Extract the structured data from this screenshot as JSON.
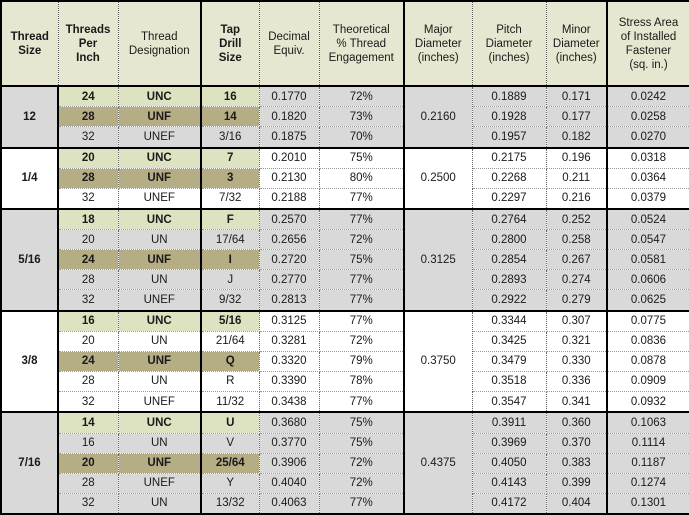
{
  "table": {
    "headers": [
      {
        "id": "thread-size",
        "lines": [
          "Thread",
          "Size"
        ],
        "bold": true
      },
      {
        "id": "threads-per-inch",
        "lines": [
          "Threads",
          "Per",
          "Inch"
        ],
        "bold": true
      },
      {
        "id": "thread-designation",
        "lines": [
          "Thread",
          "Designation"
        ],
        "bold": false
      },
      {
        "id": "tap-drill-size",
        "lines": [
          "Tap",
          "Drill",
          "Size"
        ],
        "bold": true
      },
      {
        "id": "decimal-equiv",
        "lines": [
          "Decimal",
          "Equiv."
        ],
        "bold": false
      },
      {
        "id": "thread-engagement",
        "lines": [
          "Theoretical",
          "% Thread",
          "Engagement"
        ],
        "bold": false
      },
      {
        "id": "major-diameter",
        "lines": [
          "Major",
          "Diameter",
          "(inches)"
        ],
        "bold": false
      },
      {
        "id": "pitch-diameter",
        "lines": [
          "Pitch",
          "Diameter",
          "(inches)"
        ],
        "bold": false
      },
      {
        "id": "minor-diameter",
        "lines": [
          "Minor",
          "Diameter",
          "(inches)"
        ],
        "bold": false
      },
      {
        "id": "stress-area",
        "lines": [
          "Stress Area",
          "of Installed",
          "Fastener",
          "(sq. in.)"
        ],
        "bold": false
      }
    ],
    "colors": {
      "header_bg": "#e7e6d0",
      "band_gray": "#d9d9d9",
      "band_white": "#ffffff",
      "unc_highlight": "#dde3c0",
      "unf_highlight": "#b5ad84",
      "border": "#000000"
    },
    "groups": [
      {
        "thread_size": "12",
        "major_diameter": "0.2160",
        "band": "gray",
        "rows": [
          {
            "tpi": "24",
            "designation": "UNC",
            "tap_drill": "16",
            "decimal": "0.1770",
            "engagement": "72%",
            "pitch": "0.1889",
            "minor": "0.171",
            "stress": "0.0242",
            "style": "unc"
          },
          {
            "tpi": "28",
            "designation": "UNF",
            "tap_drill": "14",
            "decimal": "0.1820",
            "engagement": "73%",
            "pitch": "0.1928",
            "minor": "0.177",
            "stress": "0.0258",
            "style": "unf"
          },
          {
            "tpi": "32",
            "designation": "UNEF",
            "tap_drill": "3/16",
            "decimal": "0.1875",
            "engagement": "70%",
            "pitch": "0.1957",
            "minor": "0.182",
            "stress": "0.0270",
            "style": "plain"
          }
        ]
      },
      {
        "thread_size": "1/4",
        "major_diameter": "0.2500",
        "band": "white",
        "rows": [
          {
            "tpi": "20",
            "designation": "UNC",
            "tap_drill": "7",
            "decimal": "0.2010",
            "engagement": "75%",
            "pitch": "0.2175",
            "minor": "0.196",
            "stress": "0.0318",
            "style": "unc"
          },
          {
            "tpi": "28",
            "designation": "UNF",
            "tap_drill": "3",
            "decimal": "0.2130",
            "engagement": "80%",
            "pitch": "0.2268",
            "minor": "0.211",
            "stress": "0.0364",
            "style": "unf"
          },
          {
            "tpi": "32",
            "designation": "UNEF",
            "tap_drill": "7/32",
            "decimal": "0.2188",
            "engagement": "77%",
            "pitch": "0.2297",
            "minor": "0.216",
            "stress": "0.0379",
            "style": "plain"
          }
        ]
      },
      {
        "thread_size": "5/16",
        "major_diameter": "0.3125",
        "band": "gray",
        "rows": [
          {
            "tpi": "18",
            "designation": "UNC",
            "tap_drill": "F",
            "decimal": "0.2570",
            "engagement": "77%",
            "pitch": "0.2764",
            "minor": "0.252",
            "stress": "0.0524",
            "style": "unc"
          },
          {
            "tpi": "20",
            "designation": "UN",
            "tap_drill": "17/64",
            "decimal": "0.2656",
            "engagement": "72%",
            "pitch": "0.2800",
            "minor": "0.258",
            "stress": "0.0547",
            "style": "plain"
          },
          {
            "tpi": "24",
            "designation": "UNF",
            "tap_drill": "I",
            "decimal": "0.2720",
            "engagement": "75%",
            "pitch": "0.2854",
            "minor": "0.267",
            "stress": "0.0581",
            "style": "unf"
          },
          {
            "tpi": "28",
            "designation": "UN",
            "tap_drill": "J",
            "decimal": "0.2770",
            "engagement": "77%",
            "pitch": "0.2893",
            "minor": "0.274",
            "stress": "0.0606",
            "style": "plain"
          },
          {
            "tpi": "32",
            "designation": "UNEF",
            "tap_drill": "9/32",
            "decimal": "0.2813",
            "engagement": "77%",
            "pitch": "0.2922",
            "minor": "0.279",
            "stress": "0.0625",
            "style": "plain"
          }
        ]
      },
      {
        "thread_size": "3/8",
        "major_diameter": "0.3750",
        "band": "white",
        "rows": [
          {
            "tpi": "16",
            "designation": "UNC",
            "tap_drill": "5/16",
            "decimal": "0.3125",
            "engagement": "77%",
            "pitch": "0.3344",
            "minor": "0.307",
            "stress": "0.0775",
            "style": "unc"
          },
          {
            "tpi": "20",
            "designation": "UN",
            "tap_drill": "21/64",
            "decimal": "0.3281",
            "engagement": "72%",
            "pitch": "0.3425",
            "minor": "0.321",
            "stress": "0.0836",
            "style": "plain"
          },
          {
            "tpi": "24",
            "designation": "UNF",
            "tap_drill": "Q",
            "decimal": "0.3320",
            "engagement": "79%",
            "pitch": "0.3479",
            "minor": "0.330",
            "stress": "0.0878",
            "style": "unf"
          },
          {
            "tpi": "28",
            "designation": "UN",
            "tap_drill": "R",
            "decimal": "0.3390",
            "engagement": "78%",
            "pitch": "0.3518",
            "minor": "0.336",
            "stress": "0.0909",
            "style": "plain"
          },
          {
            "tpi": "32",
            "designation": "UNEF",
            "tap_drill": "11/32",
            "decimal": "0.3438",
            "engagement": "77%",
            "pitch": "0.3547",
            "minor": "0.341",
            "stress": "0.0932",
            "style": "plain"
          }
        ]
      },
      {
        "thread_size": "7/16",
        "major_diameter": "0.4375",
        "band": "gray",
        "rows": [
          {
            "tpi": "14",
            "designation": "UNC",
            "tap_drill": "U",
            "decimal": "0.3680",
            "engagement": "75%",
            "pitch": "0.3911",
            "minor": "0.360",
            "stress": "0.1063",
            "style": "unc"
          },
          {
            "tpi": "16",
            "designation": "UN",
            "tap_drill": "V",
            "decimal": "0.3770",
            "engagement": "75%",
            "pitch": "0.3969",
            "minor": "0.370",
            "stress": "0.1114",
            "style": "plain"
          },
          {
            "tpi": "20",
            "designation": "UNF",
            "tap_drill": "25/64",
            "decimal": "0.3906",
            "engagement": "72%",
            "pitch": "0.4050",
            "minor": "0.383",
            "stress": "0.1187",
            "style": "unf"
          },
          {
            "tpi": "28",
            "designation": "UNEF",
            "tap_drill": "Y",
            "decimal": "0.4040",
            "engagement": "72%",
            "pitch": "0.4143",
            "minor": "0.399",
            "stress": "0.1274",
            "style": "plain"
          },
          {
            "tpi": "32",
            "designation": "UN",
            "tap_drill": "13/32",
            "decimal": "0.4063",
            "engagement": "77%",
            "pitch": "0.4172",
            "minor": "0.404",
            "stress": "0.1301",
            "style": "plain"
          }
        ]
      }
    ]
  }
}
